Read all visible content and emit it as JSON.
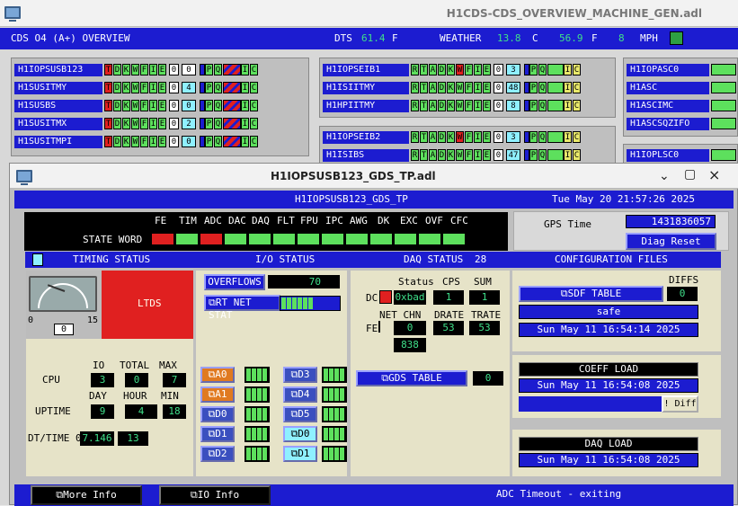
{
  "bg_window": {
    "title": "H1CDS-CDS_OVERVIEW_MACHINE_GEN.adl",
    "header": {
      "overview": "CDS O4 (A+) OVERVIEW",
      "dts_label": "DTS",
      "dts_value": "61.4",
      "dts_unit": "F",
      "weather_label": "WEATHER",
      "weather_c": "13.8",
      "c_unit": "C",
      "weather_f": "56.9",
      "f_unit": "F",
      "wind": "8",
      "wind_unit": "MPH"
    },
    "left_models": [
      "H1IOPSUSB123",
      "H1SUSITMY",
      "H1SUSBS",
      "H1SUSITMX",
      "H1SUSITMPI"
    ],
    "left_counts": [
      "0",
      "4",
      "0",
      "2",
      "0"
    ],
    "mid_models": [
      "H1IOPSEIB1",
      "H1ISIITMY",
      "H1HPIITMY"
    ],
    "mid_counts": [
      "3",
      "48",
      "8"
    ],
    "mid2_models": [
      "H1IOPSEIB2",
      "H1ISIBS"
    ],
    "mid2_counts": [
      "3",
      "47"
    ],
    "right_models": [
      "H1IOPASC0",
      "H1ASC",
      "H1ASCIMC",
      "H1ASCSQZIFO"
    ],
    "right_models2": [
      "H1IOPLSC0"
    ],
    "zero": "0",
    "cells_left": [
      "T",
      "D",
      "K",
      "W",
      "F",
      "I",
      "E"
    ],
    "cells_mid": [
      "R",
      "T",
      "A",
      "D",
      "K",
      "W",
      "F",
      "I",
      "E"
    ],
    "pq": [
      "P",
      "Q"
    ],
    "ic": [
      "I",
      "C"
    ]
  },
  "main_window": {
    "title": "H1IOPSUSB123_GDS_TP.adl",
    "controls": {
      "close": "×",
      "minimize": "⌄",
      "maximize": "▢"
    },
    "header_name": "H1IOPSUSB123_GDS_TP",
    "header_time": "Tue May 20 21:57:26 2025",
    "state_labels": [
      "FE",
      "TIM",
      "ADC",
      "DAC",
      "DAQ",
      "FLT",
      "FPU",
      "IPC",
      "AWG",
      "DK",
      "EXC",
      "OVF",
      "CFC"
    ],
    "state_word_label": "STATE WORD",
    "state_colors": [
      "#e02020",
      "#5de05d",
      "#e02020",
      "#5de05d",
      "#5de05d",
      "#5de05d",
      "#5de05d",
      "#5de05d",
      "#5de05d",
      "#5de05d",
      "#5de05d",
      "#5de05d",
      "#5de05d"
    ],
    "gps_label": "GPS Time",
    "gps_value": "1431836057",
    "diag_reset": "Diag Reset",
    "section_bar": {
      "timing": "TIMING STATUS",
      "io": "I/O STATUS",
      "daq_status": "DAQ STATUS",
      "daq_value": "28",
      "config": "CONFIGURATION FILES"
    },
    "timing": {
      "gauge_min": "0",
      "gauge_max": "15",
      "gauge_value": "0",
      "ltds": "LTDS",
      "io_hdr": "IO",
      "total_hdr": "TOTAL",
      "max_hdr": "MAX",
      "cpu_label": "CPU",
      "cpu_io": "3",
      "cpu_total": "0",
      "cpu_max": "7",
      "day_hdr": "DAY",
      "hour_hdr": "HOUR",
      "min_hdr": "MIN",
      "uptime_label": "UPTIME",
      "up_day": "9",
      "up_hour": "4",
      "up_min": "18",
      "dt_label": "DT/TIME 0",
      "dt_value": "7.146",
      "dt_value2": "13"
    },
    "io": {
      "overflows_label": "OVERFLOWS",
      "overflows_value": "70",
      "rt_net_stat": "RT NET STAT",
      "buttons_left": [
        "A0",
        "A1",
        "D0",
        "D1",
        "D2"
      ],
      "buttons_right": [
        "D3",
        "D4",
        "D5",
        "D0",
        "D1"
      ]
    },
    "daq": {
      "status_hdr": "Status",
      "cps_hdr": "CPS",
      "sum_hdr": "SUM",
      "dc_label": "DC",
      "status_value": "0xbad",
      "cps_value": "1",
      "sum_value": "1",
      "net_chn_hdr": "NET CHN",
      "drate_hdr": "DRATE",
      "trate_hdr": "TRATE",
      "fe_label": "FE",
      "net_chn_value": "0",
      "drate_value": "53",
      "trate_value": "53",
      "extra_value": "838",
      "gds_table": "GDS TABLE",
      "gds_value": "0"
    },
    "config": {
      "sdf_table": "SDF TABLE",
      "diffs_label": "DIFFS",
      "diffs_value": "0",
      "safe": "safe",
      "sdf_date": "Sun May 11 16:54:14 2025",
      "coeff_load": "COEFF LOAD",
      "coeff_date": "Sun May 11 16:54:08 2025",
      "diff_btn": "! Diff",
      "daq_load": "DAQ LOAD",
      "daq_date": "Sun May 11 16:54:08 2025"
    },
    "footer": {
      "more_info": "More Info",
      "io_info": "IO Info",
      "adc_msg": "ADC Timeout - exiting"
    }
  }
}
